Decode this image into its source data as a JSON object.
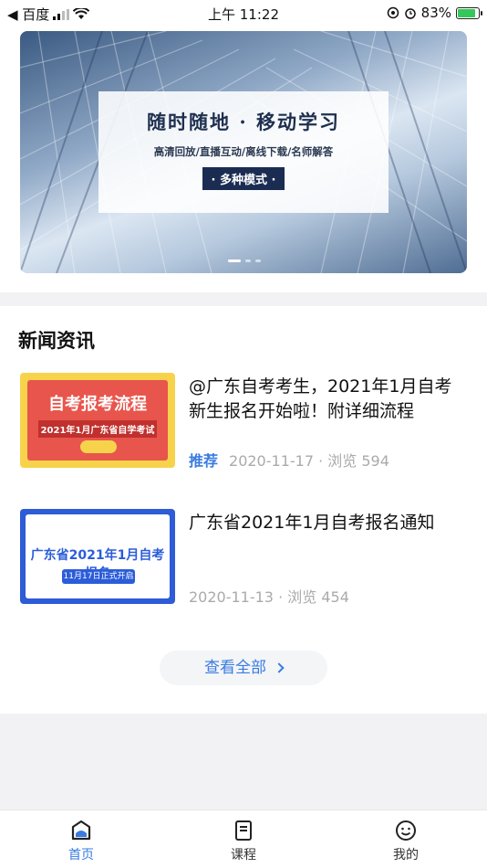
{
  "status_bar": {
    "carrier": "◀ 百度",
    "time": "上午 11:22",
    "battery": "83%"
  },
  "banner": {
    "title": "随时随地 · 移动学习",
    "subtitle": "高清回放/直播互动/离线下载/名师解答",
    "pill": "· 多种模式 ·",
    "pages": 3,
    "active_page": 1
  },
  "news": {
    "section_title": "新闻资讯",
    "items": [
      {
        "title": "@广东自考考生，2021年1月自考新生报名开始啦！附详细流程",
        "tag": "推荐",
        "meta": "2020-11-17 · 浏览 594",
        "thumb_title": "自考报考流程",
        "thumb_sub": "2021年1月广东省自学考试"
      },
      {
        "title": "广东省2021年1月自考报名通知",
        "tag": "",
        "meta": "2020-11-13 · 浏览 454",
        "thumb_title": "广东省2021年1月自考报名",
        "thumb_sub": "11月17日正式开启"
      }
    ],
    "view_all": "查看全部"
  },
  "tabs": [
    {
      "label": "首页",
      "icon": "home-icon",
      "active": true
    },
    {
      "label": "课程",
      "icon": "course-book-icon",
      "active": false
    },
    {
      "label": "我的",
      "icon": "smiley-profile-icon",
      "active": false
    }
  ],
  "colors": {
    "accent": "#3a7be2",
    "banner_pill": "#1b2c52"
  }
}
